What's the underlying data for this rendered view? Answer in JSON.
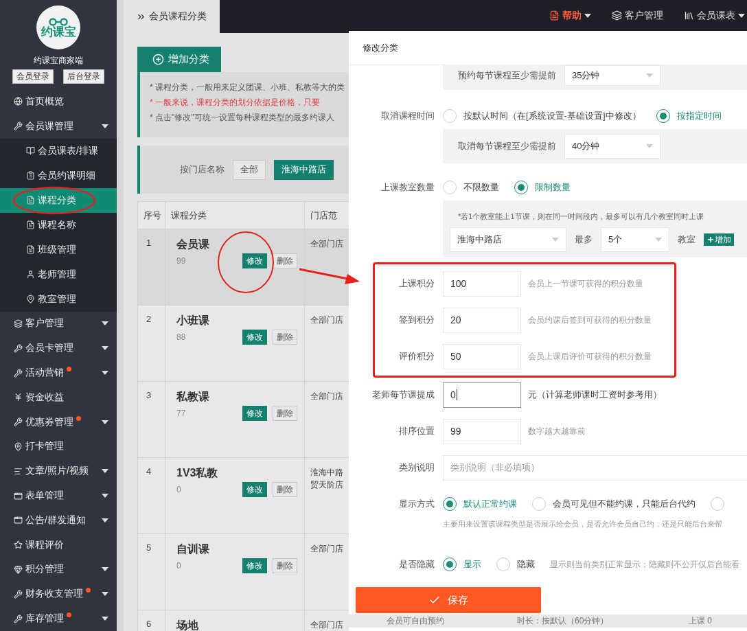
{
  "sidebar": {
    "brand": "约课宝",
    "title": "约课宝商家端",
    "login_buttons": [
      "会员登录",
      "后台登录"
    ],
    "items": [
      {
        "label": "首页概览",
        "has_submenu": false,
        "new_dot": false,
        "selected": false
      },
      {
        "label": "会员课管理",
        "has_submenu": true,
        "new_dot": false,
        "selected": false,
        "expanded": true,
        "children": [
          {
            "label": "会员课表/排课",
            "selected": false
          },
          {
            "label": "会员约课明细",
            "selected": false
          },
          {
            "label": "课程分类",
            "selected": true
          },
          {
            "label": "课程名称",
            "selected": false
          },
          {
            "label": "班级管理",
            "selected": false
          },
          {
            "label": "老师管理",
            "selected": false
          },
          {
            "label": "教室管理",
            "selected": false
          }
        ]
      },
      {
        "label": "客户管理",
        "has_submenu": true,
        "new_dot": false,
        "selected": false,
        "expanded": false
      },
      {
        "label": "会员卡管理",
        "has_submenu": true,
        "new_dot": false,
        "selected": false,
        "expanded": false
      },
      {
        "label": "活动营销",
        "has_submenu": true,
        "new_dot": true,
        "selected": false,
        "expanded": false
      },
      {
        "label": "资金收益",
        "has_submenu": false,
        "new_dot": false,
        "selected": false
      },
      {
        "label": "优惠券管理",
        "has_submenu": true,
        "new_dot": true,
        "selected": false,
        "expanded": false
      },
      {
        "label": "打卡管理",
        "has_submenu": false,
        "new_dot": false,
        "selected": false
      },
      {
        "label": "文章/照片/视频",
        "has_submenu": true,
        "new_dot": false,
        "selected": false,
        "expanded": false
      },
      {
        "label": "表单管理",
        "has_submenu": true,
        "new_dot": false,
        "selected": false,
        "expanded": false
      },
      {
        "label": "公告/群发通知",
        "has_submenu": true,
        "new_dot": false,
        "selected": false,
        "expanded": false
      },
      {
        "label": "课程评价",
        "has_submenu": false,
        "new_dot": false,
        "selected": false
      },
      {
        "label": "积分管理",
        "has_submenu": true,
        "new_dot": false,
        "selected": false,
        "expanded": false
      },
      {
        "label": "财务收支管理",
        "has_submenu": true,
        "new_dot": true,
        "selected": false,
        "expanded": false
      },
      {
        "label": "库存管理",
        "has_submenu": true,
        "new_dot": true,
        "selected": false,
        "expanded": false
      }
    ]
  },
  "topbar": {
    "items": [
      {
        "label": "帮助",
        "highlighted": true,
        "has_dropdown": true
      },
      {
        "label": "客户管理",
        "highlighted": false,
        "has_dropdown": false
      },
      {
        "label": "会员课表",
        "highlighted": false,
        "has_dropdown": true
      }
    ]
  },
  "main": {
    "breadcrumb": "会员课程分类",
    "add_button": "增加分类",
    "notes": [
      {
        "text": "* 课程分类，一般用来定义团课、小班、私教等大的类",
        "emphasis": false
      },
      {
        "text": "* 一般来说，课程分类的划分依据是价格，只要",
        "emphasis": true
      },
      {
        "text": "* 点击\"修改\"可统一设置每种课程类型的最多约课人",
        "emphasis": false
      }
    ],
    "filter": {
      "label": "按门店名称",
      "options": [
        {
          "label": "全部",
          "selected": false
        },
        {
          "label": "淮海中路店",
          "selected": true
        }
      ]
    },
    "table": {
      "columns": [
        "序号",
        "课程分类",
        "门店范"
      ],
      "rows": [
        {
          "index": "1",
          "name": "会员课",
          "count": "99",
          "stores": [
            "全部门店"
          ],
          "actions": [
            "修改",
            "删除"
          ],
          "highlighted": true
        },
        {
          "index": "2",
          "name": "小班课",
          "count": "88",
          "stores": [
            "全部门店"
          ],
          "actions": [
            "修改",
            "删除"
          ],
          "highlighted": false
        },
        {
          "index": "3",
          "name": "私教课",
          "count": "77",
          "stores": [
            "全部门店"
          ],
          "actions": [
            "修改",
            "删除"
          ],
          "highlighted": false
        },
        {
          "index": "4",
          "name": "1V3私教",
          "count": "0",
          "stores": [
            "淮海中路",
            "贸天阶店"
          ],
          "actions": [
            "修改",
            "删除"
          ],
          "highlighted": false
        },
        {
          "index": "5",
          "name": "自训课",
          "count": "0",
          "stores": [
            "全部门店"
          ],
          "actions": [
            "修改",
            "删除"
          ],
          "highlighted": false
        },
        {
          "index": "6",
          "name": "场地",
          "stores": [
            "全部门店"
          ],
          "highlighted": false
        }
      ]
    }
  },
  "modal": {
    "title": "修改分类",
    "advance_booking": {
      "label": "预约每节课程至少需提前",
      "value": "35分钟"
    },
    "cancel_time": {
      "label": "取消课程时间",
      "options": [
        {
          "label": "按默认时间（在[系统设置-基础设置]中修改）",
          "selected": false
        },
        {
          "label": "按指定时间",
          "selected": true
        }
      ],
      "sub_label": "取消每节课程至少需提前",
      "sub_value": "40分钟"
    },
    "classrooms": {
      "label": "上课教室数量",
      "options": [
        {
          "label": "不限数量",
          "selected": false
        },
        {
          "label": "限制数量",
          "selected": true
        }
      ],
      "note": "*若1个教室能上1节课，则在同一时间段内，最多可以有几个教室同时上课",
      "store": "淮海中路店",
      "max_label": "最多",
      "max_value": "5个",
      "unit": "教室",
      "add_button": "增加"
    },
    "points": [
      {
        "label": "上课积分",
        "value": "100",
        "hint": "会员上一节课可获得的积分数量"
      },
      {
        "label": "签到积分",
        "value": "20",
        "hint": "会员约课后签到可获得的积分数量"
      },
      {
        "label": "评价积分",
        "value": "50",
        "hint": "会员上课后评价可获得的积分数量"
      }
    ],
    "commission": {
      "label": "老师每节课提成",
      "value": "0",
      "suffix": "元（计算老师课时工资时参考用）"
    },
    "sort": {
      "label": "排序位置",
      "value": "99",
      "hint": "数字越大越靠前"
    },
    "description": {
      "label": "类别说明",
      "placeholder": "类别说明（非必填项）"
    },
    "display": {
      "label": "显示方式",
      "options": [
        {
          "label": "默认正常约课",
          "selected": true
        },
        {
          "label": "会员可见但不能约课，只能后台代约",
          "selected": false
        },
        {
          "selected": false
        }
      ],
      "hint": "主要用来设置该课程类型是否展示给会员，是否允许会员自己约，还是只能后台来帮"
    },
    "hidden": {
      "label": "是否隐藏",
      "options": [
        {
          "label": "显示",
          "selected": true
        },
        {
          "label": "隐藏",
          "selected": false
        }
      ],
      "hint": "显示则当前类别正常显示；隐藏则不公开仅后台能看"
    },
    "save_button": "保存",
    "behind_row": [
      "会员可自由预约",
      "时长：按默认（60分钟）",
      "上课 0"
    ]
  }
}
